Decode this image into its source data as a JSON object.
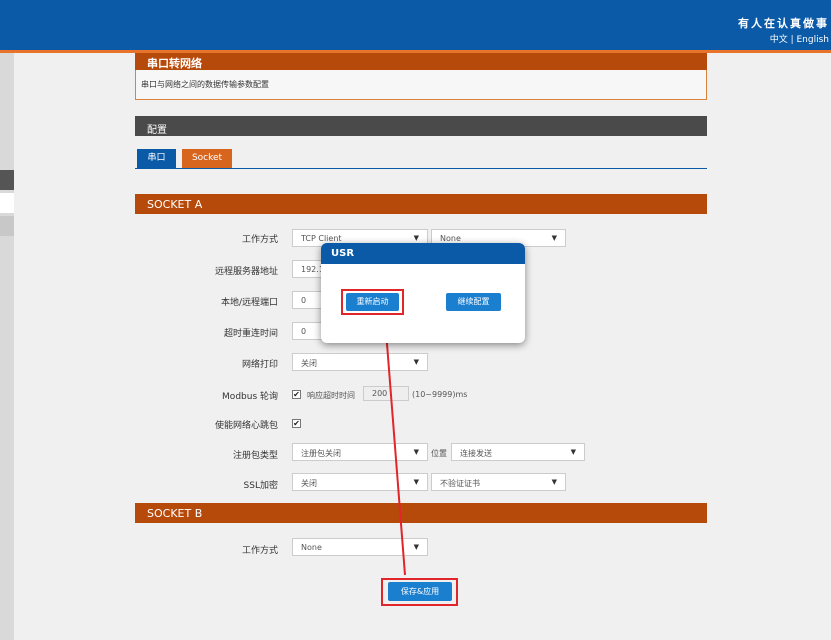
{
  "header": {
    "brand": "有人在认真做事",
    "lang_zh": "中文",
    "lang_sep": " | ",
    "lang_en": "English"
  },
  "intro": {
    "title": "串口转网络",
    "desc": "串口与网络之间的数据传输参数配置"
  },
  "config": {
    "title": "配置",
    "tabs": [
      {
        "label": "串口"
      },
      {
        "label": "Socket"
      }
    ]
  },
  "socket_a": {
    "title": "SOCKET A",
    "work_mode_label": "工作方式",
    "work_mode_value": "TCP Client",
    "work_mode_extra": "None",
    "remote_server_label": "远程服务器地址",
    "remote_server_value": "192.1",
    "port_label": "本地/远程端口",
    "port_value": "0",
    "reconnect_label": "超时重连时间",
    "reconnect_value": "0",
    "net_print_label": "网络打印",
    "net_print_value": "关闭",
    "modbus_label": "Modbus 轮询",
    "modbus_timeout_label": "响应超时时间",
    "modbus_timeout_value": "200",
    "modbus_range": "(10~9999)ms",
    "heartbeat_label": "使能网络心跳包",
    "register_label": "注册包类型",
    "register_value": "注册包关闭",
    "position_label": "位置",
    "position_value": "连接发送",
    "ssl_label": "SSL加密",
    "ssl_value": "关闭",
    "cert_value": "不验证证书"
  },
  "socket_b": {
    "title": "SOCKET B",
    "work_mode_label": "工作方式",
    "work_mode_value": "None"
  },
  "save_button": "保存&应用",
  "modal": {
    "title": "USR",
    "restart_button": "重新启动",
    "continue_button": "继续配置"
  },
  "colors": {
    "header_blue": "#0a5aa8",
    "section_orange": "#b64a0a",
    "highlight_red": "#e0262a"
  }
}
